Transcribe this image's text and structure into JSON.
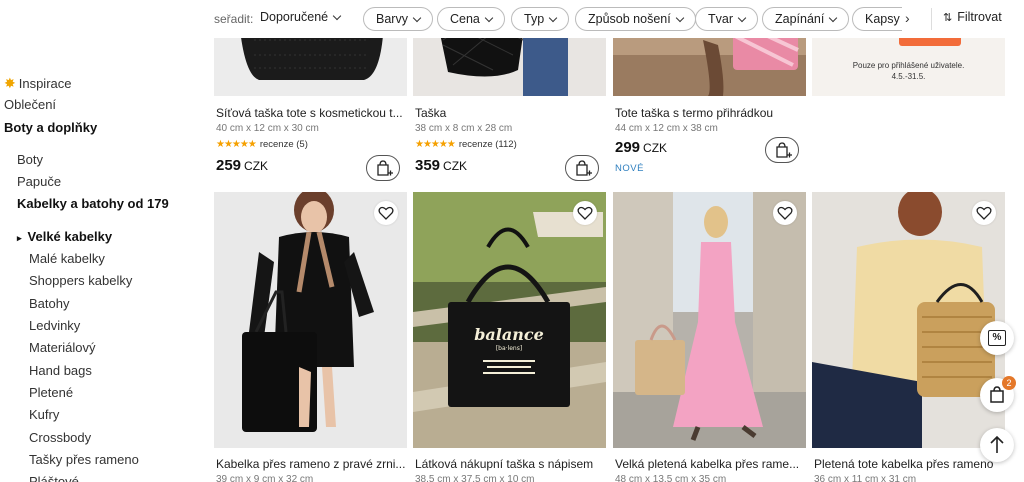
{
  "toolbar": {
    "sort_label": "seřadit:",
    "sort_value": "Doporučené",
    "chips": [
      "Barvy",
      "Cena",
      "Typ",
      "Způsob nošení",
      "Tvar",
      "Zapínání"
    ],
    "clipped_chip": "Kapsy",
    "filter_label": "Filtrovat"
  },
  "sidebar": {
    "top": [
      "Inspirace",
      "Oblečení",
      "Boty a doplňky"
    ],
    "sub": [
      "Boty",
      "Papuče",
      "Kabelky a batohy od 179"
    ],
    "current": "Velké kabelky",
    "items": [
      "Malé kabelky",
      "Shoppers kabelky",
      "Batohy",
      "Ledvinky",
      "Materiálový",
      "Hand bags",
      "Pletené",
      "Kufry",
      "Crossbody",
      "Tašky přes rameno",
      "Pláštové"
    ]
  },
  "row1": [
    {
      "title": "Síťová taška tote s kosmetickou t...",
      "dims": "40 cm x 12 cm x 30 cm",
      "stars": "★★★★★",
      "reviews": "recenze (5)",
      "price": "259",
      "currency": "CZK"
    },
    {
      "title": "Taška",
      "dims": "38 cm x 8 cm x 28 cm",
      "stars": "★★★★★",
      "reviews": "recenze (112)",
      "price": "359",
      "currency": "CZK"
    },
    {
      "title": "Tote taška s termo přihrádkou",
      "dims": "44 cm x 12 cm x 38 cm",
      "price": "299",
      "currency": "CZK",
      "badge": "NOVÉ"
    }
  ],
  "promo": {
    "line1": "Pouze pro přihlášené uživatele.",
    "line2": "4.5.-31.5."
  },
  "row2": [
    {
      "title": "Kabelka přes rameno z pravé zrni...",
      "dims": "39 cm x 9 cm x 32 cm"
    },
    {
      "title": "Látková nákupní taška s nápisem",
      "dims": "38.5 cm x 37.5 cm x 10 cm"
    },
    {
      "title": "Velká pletená kabelka přes rame...",
      "dims": "48 cm x 13.5 cm x 35 cm"
    },
    {
      "title": "Pletená tote kabelka přes rameno",
      "dims": "36 cm x 11 cm x 31 cm"
    }
  ],
  "bag_print": {
    "word": "balance",
    "sub": "[ba·lens]"
  },
  "floating": {
    "discount_icon": "%",
    "cart_count": "2"
  }
}
